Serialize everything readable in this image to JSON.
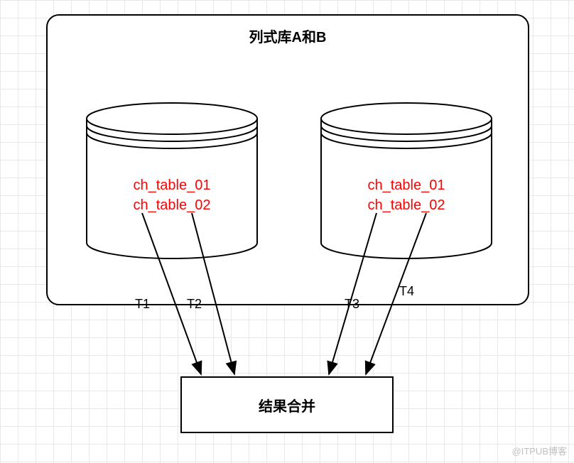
{
  "container": {
    "title": "列式库A和B"
  },
  "cylinders": {
    "left": {
      "table1": "ch_table_01",
      "table2": "ch_table_02"
    },
    "right": {
      "table1": "ch_table_01",
      "table2": "ch_table_02"
    }
  },
  "arrows": {
    "t1": "T1",
    "t2": "T2",
    "t3": "T3",
    "t4": "T4"
  },
  "result": {
    "label": "结果合并"
  },
  "watermark": "@ITPUB博客"
}
